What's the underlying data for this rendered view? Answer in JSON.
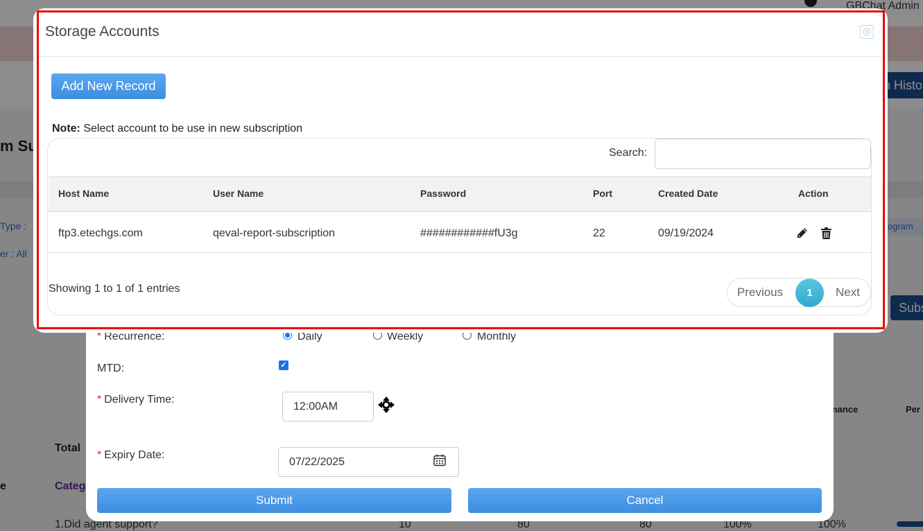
{
  "background": {
    "user_name": "GBChat Admin",
    "history_button": "n Histo",
    "page_title": "m Su",
    "filter_type": "Type : ",
    "filter_all": "er : All",
    "program_pill": "ogram",
    "subscribe_button": "Subs",
    "col_performance": "mance",
    "col_percent": "Per",
    "total_label": "Total",
    "category_label": "Categ",
    "e_label": "e",
    "row": {
      "question": "1.Did agent support?",
      "v1": "10",
      "v2": "80",
      "v3": "80",
      "v4": "100%",
      "v5": "100%"
    }
  },
  "form": {
    "recurrence_label": "Recurrence:",
    "recurrence_options": [
      "Daily",
      "Weekly",
      "Monthly"
    ],
    "recurrence_selected": "Daily",
    "mtd_label": "MTD:",
    "mtd_checked": true,
    "delivery_time_label": "Delivery Time:",
    "delivery_time_value": "12:00AM",
    "expiry_date_label": "Expiry Date:",
    "expiry_date_value": "07/22/2025",
    "submit_label": "Submit",
    "cancel_label": "Cancel"
  },
  "storage_modal": {
    "title": "Storage Accounts",
    "add_button": "Add New Record",
    "note_bold": "Note:",
    "note_text": "Select account to be use in new subscription",
    "search_label": "Search:",
    "search_value": "",
    "columns": [
      "Host Name",
      "User Name",
      "Password",
      "Port",
      "Created Date",
      "Action"
    ],
    "rows": [
      {
        "host": "ftp3.etechgs.com",
        "user": "qeval-report-subscription",
        "password": "############fU3g",
        "port": "22",
        "created": "09/19/2024"
      }
    ],
    "info": "Showing 1 to 1 of 1 entries",
    "pagination": {
      "previous": "Previous",
      "current": "1",
      "next": "Next"
    },
    "highlight_color": "#ee0000",
    "accent_color": "#4a9be8"
  }
}
